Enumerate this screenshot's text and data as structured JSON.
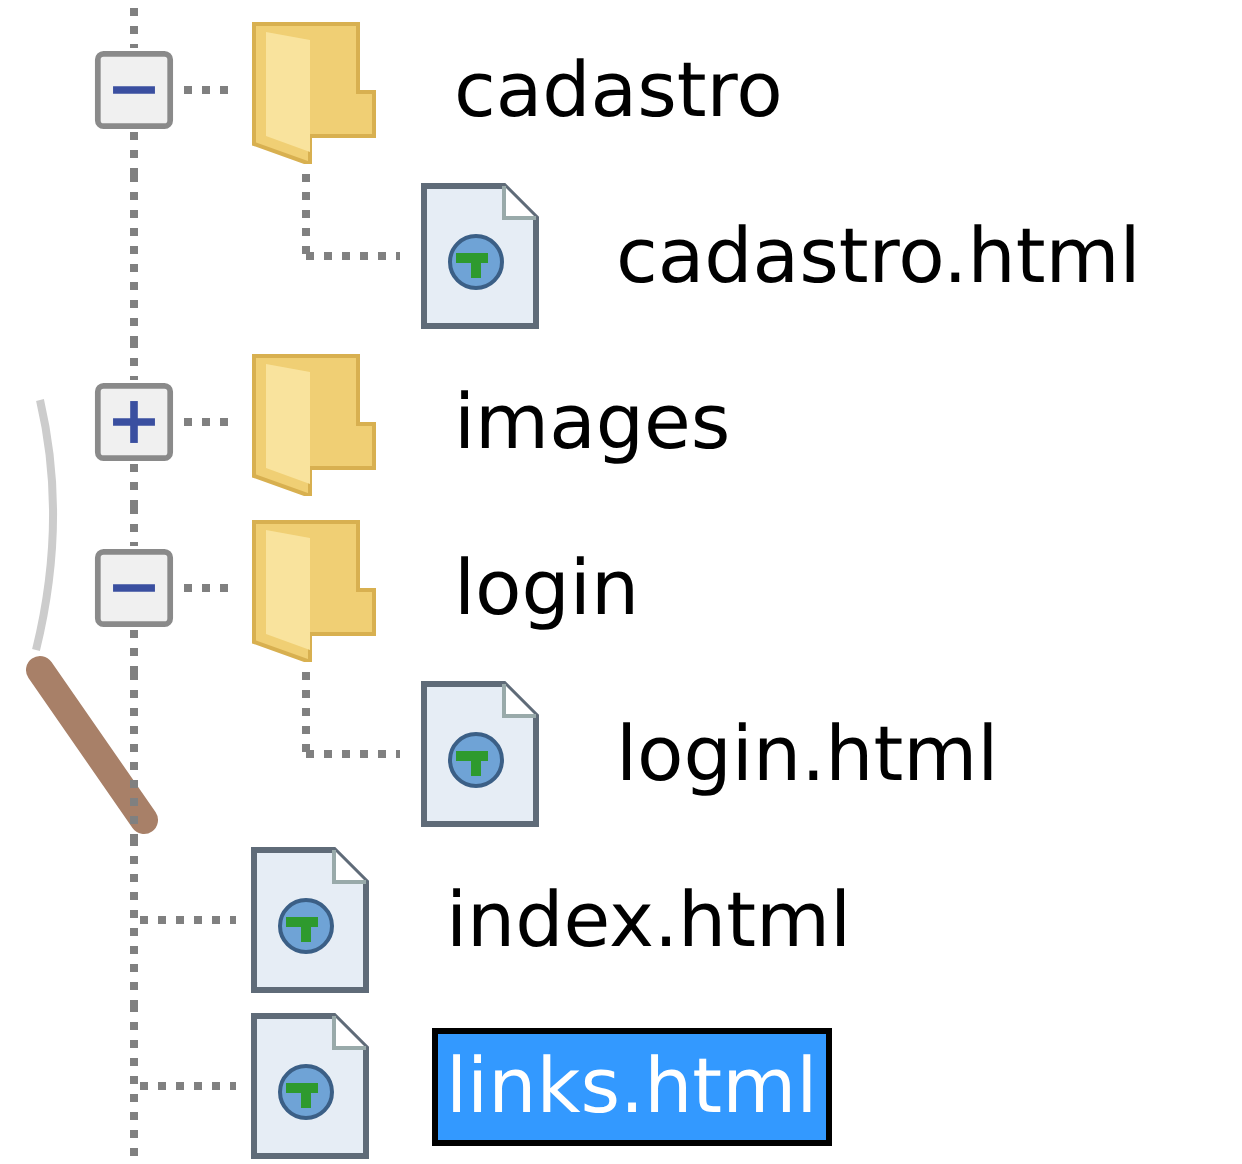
{
  "tree": [
    {
      "label": "cadastro",
      "kind": "folder",
      "expanded": true,
      "selected": false,
      "children": [
        {
          "label": "cadastro.html",
          "kind": "file",
          "selected": false
        }
      ]
    },
    {
      "label": "images",
      "kind": "folder",
      "expanded": false,
      "selected": false
    },
    {
      "label": "login",
      "kind": "folder",
      "expanded": true,
      "selected": false,
      "children": [
        {
          "label": "login.html",
          "kind": "file",
          "selected": false
        }
      ]
    },
    {
      "label": "index.html",
      "kind": "file",
      "selected": false
    },
    {
      "label": "links.html",
      "kind": "file",
      "selected": true
    }
  ]
}
